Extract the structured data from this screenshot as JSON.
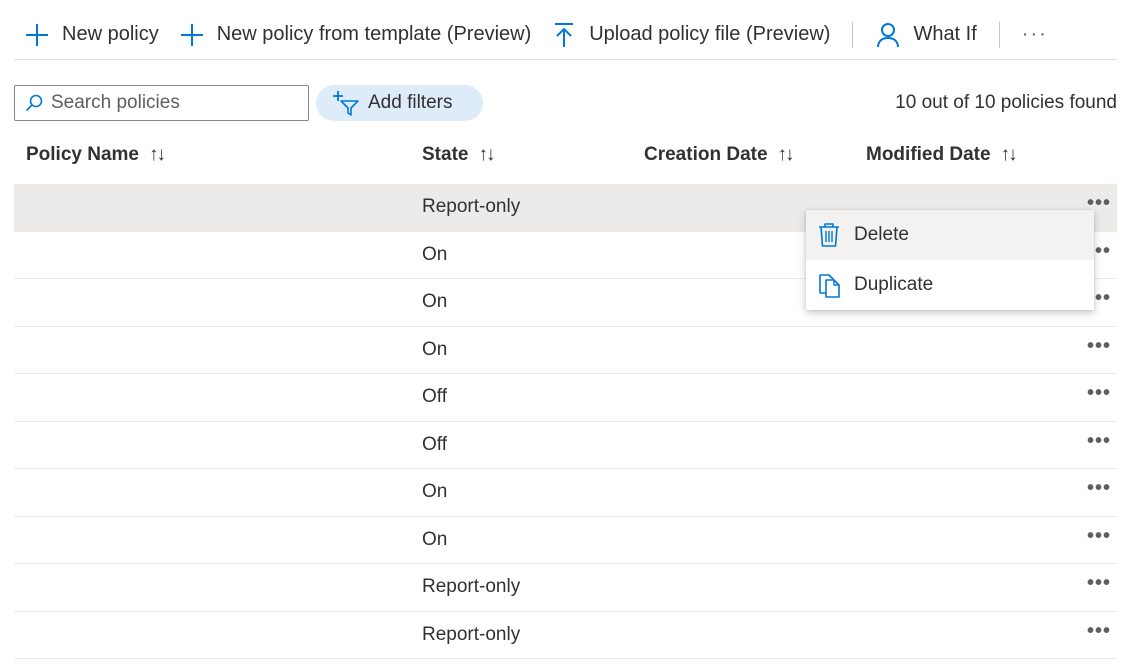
{
  "toolbar": {
    "new_policy": "New policy",
    "new_from_template": "New policy from template (Preview)",
    "upload_policy": "Upload policy file (Preview)",
    "what_if": "What If",
    "more": "···"
  },
  "search": {
    "placeholder": "Search policies",
    "value": ""
  },
  "filters": {
    "label": "Add filters"
  },
  "result_count": "10 out of 10 policies found",
  "columns": {
    "policy_name": "Policy Name",
    "state": "State",
    "creation_date": "Creation Date",
    "modified_date": "Modified Date",
    "sort_glyph": "↑↓"
  },
  "rows": [
    {
      "policy_name": "",
      "state": "Report-only",
      "creation_date": "",
      "modified_date": "",
      "more": "•••"
    },
    {
      "policy_name": "",
      "state": "On",
      "creation_date": "",
      "modified_date": "",
      "more": "•••"
    },
    {
      "policy_name": "",
      "state": "On",
      "creation_date": "",
      "modified_date": "",
      "more": "•••"
    },
    {
      "policy_name": "",
      "state": "On",
      "creation_date": "",
      "modified_date": "",
      "more": "•••"
    },
    {
      "policy_name": "",
      "state": "Off",
      "creation_date": "",
      "modified_date": "",
      "more": "•••"
    },
    {
      "policy_name": "",
      "state": "Off",
      "creation_date": "",
      "modified_date": "",
      "more": "•••"
    },
    {
      "policy_name": "",
      "state": "On",
      "creation_date": "",
      "modified_date": "",
      "more": "•••"
    },
    {
      "policy_name": "",
      "state": "On",
      "creation_date": "",
      "modified_date": "",
      "more": "•••"
    },
    {
      "policy_name": "",
      "state": "Report-only",
      "creation_date": "",
      "modified_date": "",
      "more": "•••"
    },
    {
      "policy_name": "",
      "state": "Report-only",
      "creation_date": "",
      "modified_date": "",
      "more": "•••"
    }
  ],
  "context_menu": {
    "delete": "Delete",
    "duplicate": "Duplicate"
  },
  "colors": {
    "accent": "#0078d4",
    "filter_pill": "#deecf9",
    "selected_row": "#edebe9",
    "text": "#323130"
  },
  "icons": {
    "new_policy": "plus-icon",
    "new_from_template": "plus-icon",
    "upload_policy": "upload-icon",
    "what_if": "person-icon",
    "search": "search-icon",
    "filters": "add-filter-icon",
    "delete": "trash-icon",
    "duplicate": "copy-icon"
  }
}
